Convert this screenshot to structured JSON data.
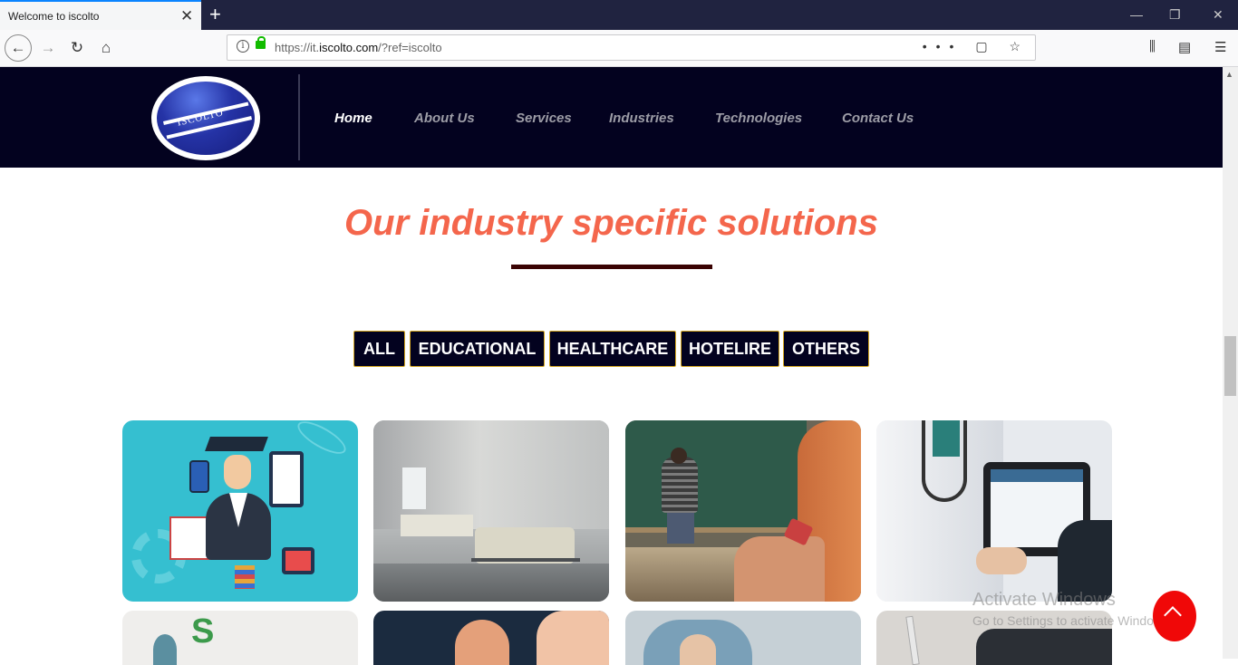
{
  "browser": {
    "tab_title": "Welcome to iscolto",
    "tab_close": "✕",
    "new_tab": "+",
    "url_prefix": "https://it.",
    "url_domain": "iscolto.com",
    "url_path": "/?ref=iscolto",
    "page_actions": "••• ▢ ☆",
    "window_controls": [
      "—",
      "❐",
      "✕"
    ]
  },
  "site": {
    "logo_text": "ISCOLTO",
    "menu": [
      {
        "label": "Home",
        "active": true
      },
      {
        "label": "About Us",
        "active": false
      },
      {
        "label": "Services",
        "active": false
      },
      {
        "label": "Industries",
        "active": false
      },
      {
        "label": "Technologies",
        "active": false
      },
      {
        "label": "Contact Us",
        "active": false
      }
    ]
  },
  "section": {
    "title": "Our industry specific solutions",
    "filters": [
      "ALL",
      "EDUCATIONAL",
      "HEALTHCARE",
      "HOTELIRE",
      "OTHERS"
    ]
  },
  "cards": [
    {
      "icon": "education-illustration"
    },
    {
      "icon": "hospital-ward-photo"
    },
    {
      "icon": "classroom-photo"
    },
    {
      "icon": "doctor-tablet-photo"
    },
    {
      "icon": "kids-learning-photo"
    },
    {
      "icon": "office-meeting-photo"
    },
    {
      "icon": "surgery-photo"
    },
    {
      "icon": "document-signing-photo"
    }
  ],
  "watermark": {
    "title": "Activate Windows",
    "subtitle": "Go to Settings to activate Windows."
  },
  "colors": {
    "header_bg": "#03021f",
    "title": "#f4664c",
    "filter_border": "#d4a520",
    "to_top": "#f00808"
  }
}
